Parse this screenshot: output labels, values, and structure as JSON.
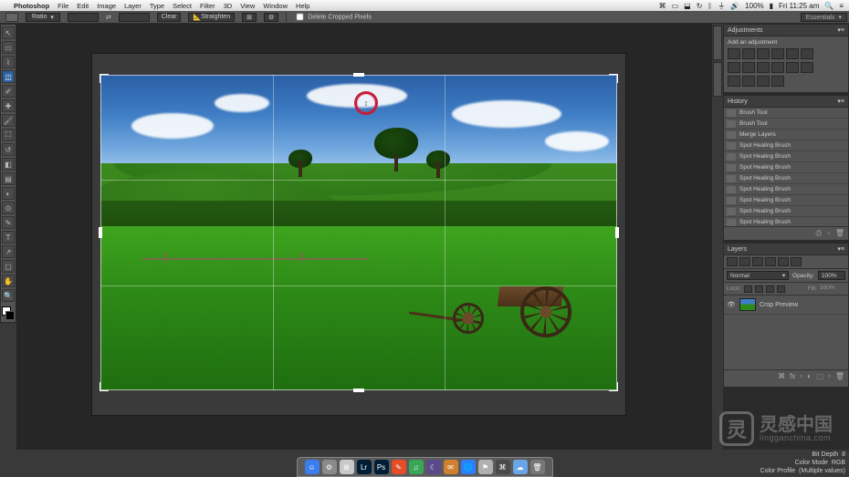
{
  "menubar": {
    "app": "Photoshop",
    "items": [
      "File",
      "Edit",
      "Image",
      "Layer",
      "Type",
      "Select",
      "Filter",
      "3D",
      "View",
      "Window",
      "Help"
    ],
    "status": {
      "battery": "100%",
      "clock": "Fri 11:25 am"
    }
  },
  "options": {
    "ratio": "Ratio",
    "clear": "Clear",
    "straighten": "Straighten",
    "delete_cropped": "Delete Cropped Pixels"
  },
  "workspace_picker": "Essentials",
  "tools": [
    "↖",
    "▭",
    "◫",
    "✂",
    "✐",
    "✚",
    "◐",
    "✎",
    "⌨",
    "⬚",
    "◉",
    "✦",
    "T",
    "↗",
    "▢",
    "✋",
    "🔍"
  ],
  "panels": {
    "adjustments": {
      "tab": "Adjustments",
      "hint": "Add an adjustment"
    },
    "history": {
      "tab": "History",
      "items": [
        "Brush Tool",
        "Brush Tool",
        "Merge Layers",
        "Spot Healing Brush",
        "Spot Healing Brush",
        "Spot Healing Brush",
        "Spot Healing Brush",
        "Spot Healing Brush",
        "Spot Healing Brush",
        "Spot Healing Brush",
        "Spot Healing Brush",
        "Spot Healing Brush"
      ]
    },
    "layers": {
      "tab": "Layers",
      "blend": "Normal",
      "opacity_lbl": "Opacity:",
      "opacity_val": "100%",
      "lock_lbl": "Lock:",
      "fill_lbl": "Fill:",
      "fill_val": "100%",
      "layer0": "Crop Preview"
    }
  },
  "info": {
    "bitdepth_lbl": "Bit Depth",
    "bitdepth_val": "8",
    "mode_lbl": "Color Mode",
    "mode_val": "RGB",
    "profile_lbl": "Color Profile",
    "profile_val": "(Multiple values)"
  },
  "watermark": {
    "cn": "灵感中国",
    "en": "lingganchina.com"
  },
  "dock": [
    {
      "c": "#3b7ded",
      "t": "☺"
    },
    {
      "c": "#8a8a8a",
      "t": "⚙"
    },
    {
      "c": "#c9c9c9",
      "t": "⊞"
    },
    {
      "c": "#001e36",
      "t": "Lr"
    },
    {
      "c": "#001e36",
      "t": "Ps"
    },
    {
      "c": "#e44d26",
      "t": "✎"
    },
    {
      "c": "#3aa757",
      "t": "♫"
    },
    {
      "c": "#5b4a8a",
      "t": "☾"
    },
    {
      "c": "#d08030",
      "t": "✉"
    },
    {
      "c": "#2a7fff",
      "t": "🌐"
    },
    {
      "c": "#b0b0b0",
      "t": "⚑"
    },
    {
      "c": "#4a4a4a",
      "t": "⌘"
    },
    {
      "c": "#6aa6e8",
      "t": "☁"
    },
    {
      "c": "#777",
      "t": "🗑"
    }
  ]
}
